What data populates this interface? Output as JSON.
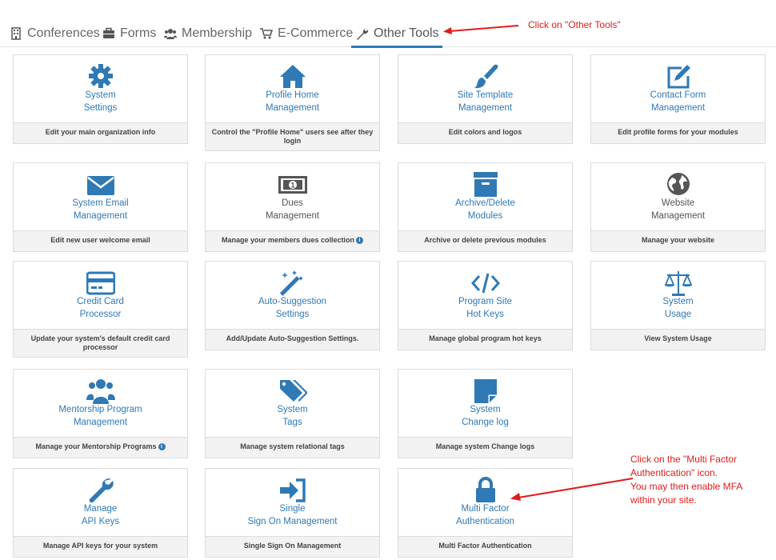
{
  "tabs": [
    {
      "label": "Conferences",
      "icon": "building-icon"
    },
    {
      "label": "Forms",
      "icon": "briefcase-icon"
    },
    {
      "label": "Membership",
      "icon": "users-icon"
    },
    {
      "label": "E-Commerce",
      "icon": "cart-icon"
    },
    {
      "label": "Other Tools",
      "icon": "wrench-icon"
    }
  ],
  "cards": [
    {
      "title1": "System",
      "title2": "Settings",
      "desc": "Edit your main organization info",
      "icon": "gear-icon"
    },
    {
      "title1": "Profile Home",
      "title2": "Management",
      "desc": "Control the \"Profile Home\" users see after they login",
      "icon": "home-icon"
    },
    {
      "title1": "Site Template",
      "title2": "Management",
      "desc": "Edit colors and logos",
      "icon": "paintbrush-icon"
    },
    {
      "title1": "Contact Form",
      "title2": "Management",
      "desc": "Edit profile forms for your modules",
      "icon": "edit-icon"
    },
    {
      "title1": "System Email",
      "title2": "Management",
      "desc": "Edit new user welcome email",
      "icon": "envelope-icon"
    },
    {
      "title1": "Dues",
      "title2": "Management",
      "desc": "Manage your members dues collection",
      "icon": "money-icon"
    },
    {
      "title1": "Archive/Delete",
      "title2": "Modules",
      "desc": "Archive or delete previous modules",
      "icon": "archive-icon"
    },
    {
      "title1": "Website",
      "title2": "Management",
      "desc": "Manage your website",
      "icon": "globe-icon"
    },
    {
      "title1": "Credit Card",
      "title2": "Processor",
      "desc": "Update your system's default credit card processor",
      "icon": "credit-card-icon"
    },
    {
      "title1": "Auto-Suggestion",
      "title2": "Settings",
      "desc": "Add/Update Auto-Suggestion Settings.",
      "icon": "magic-wand-icon"
    },
    {
      "title1": "Program Site",
      "title2": "Hot Keys",
      "desc": "Manage global program hot keys",
      "icon": "code-icon"
    },
    {
      "title1": "System",
      "title2": "Usage",
      "desc": "View System Usage",
      "icon": "balance-scale-icon"
    },
    {
      "title1": "Mentorship Program",
      "title2": "Management",
      "desc": "Manage your Mentorship Programs",
      "icon": "group-icon"
    },
    {
      "title1": "System",
      "title2": "Tags",
      "desc": "Manage system relational tags",
      "icon": "tags-icon"
    },
    {
      "title1": "System",
      "title2": "Change log",
      "desc": "Manage system Change logs",
      "icon": "sticky-note-icon"
    },
    {
      "title1": "Manage",
      "title2": "API Keys",
      "desc": "Manage API keys for your system",
      "icon": "wrench-icon"
    },
    {
      "title1": "Single",
      "title2": "Sign On Management",
      "desc": "Single Sign On Management",
      "icon": "sign-in-icon"
    },
    {
      "title1": "Multi Factor",
      "title2": "Authentication",
      "desc": "Multi Factor Authentication",
      "icon": "lock-icon"
    }
  ],
  "annotations": {
    "tools": "Click on \"Other Tools\"",
    "mfa1": "Click on the \"Multi Factor",
    "mfa2": "Authentication\" icon.",
    "mfa3": "You may then enable MFA",
    "mfa4": "within your site."
  },
  "colors": {
    "accent": "#2f79b5",
    "annotation": "#e01b1b"
  }
}
